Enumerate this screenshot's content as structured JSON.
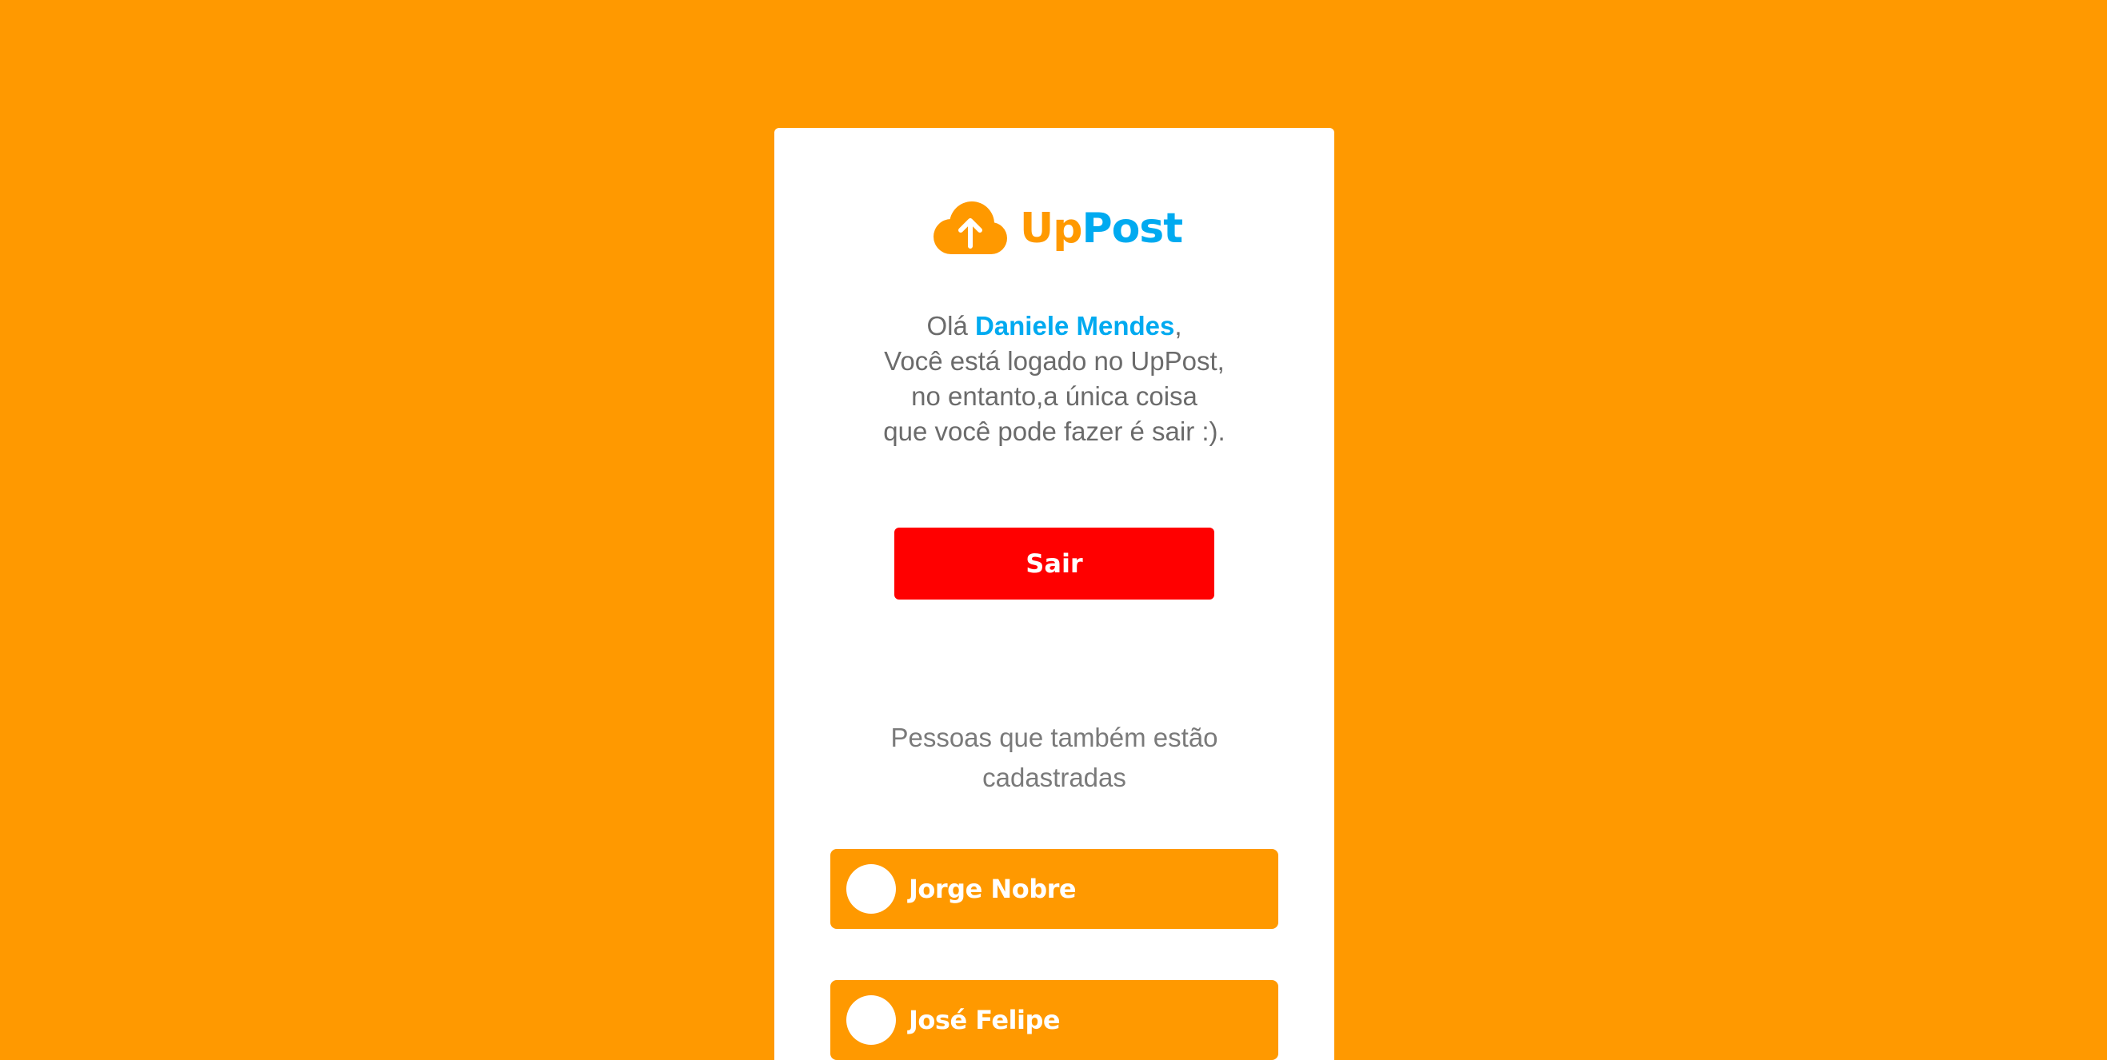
{
  "brand": {
    "logo_icon": "cloud-upload-icon",
    "name_part1": "Up",
    "name_part2": "Post",
    "colors": {
      "orange": "#FF9900",
      "blue": "#00AAF0",
      "danger": "#FF0000"
    }
  },
  "greeting": {
    "hello": "Olá",
    "user_name": "Daniele Mendes",
    "comma": ",",
    "line2": "Você está logado no UpPost,",
    "line3": "no entanto,a única coisa",
    "line4": "que você pode fazer é sair :)."
  },
  "actions": {
    "logout_label": "Sair"
  },
  "users_section": {
    "heading_line1": "Pessoas que também estão",
    "heading_line2": "cadastradas",
    "users": [
      {
        "name": "Jorge Nobre"
      },
      {
        "name": "José Felipe"
      }
    ]
  }
}
